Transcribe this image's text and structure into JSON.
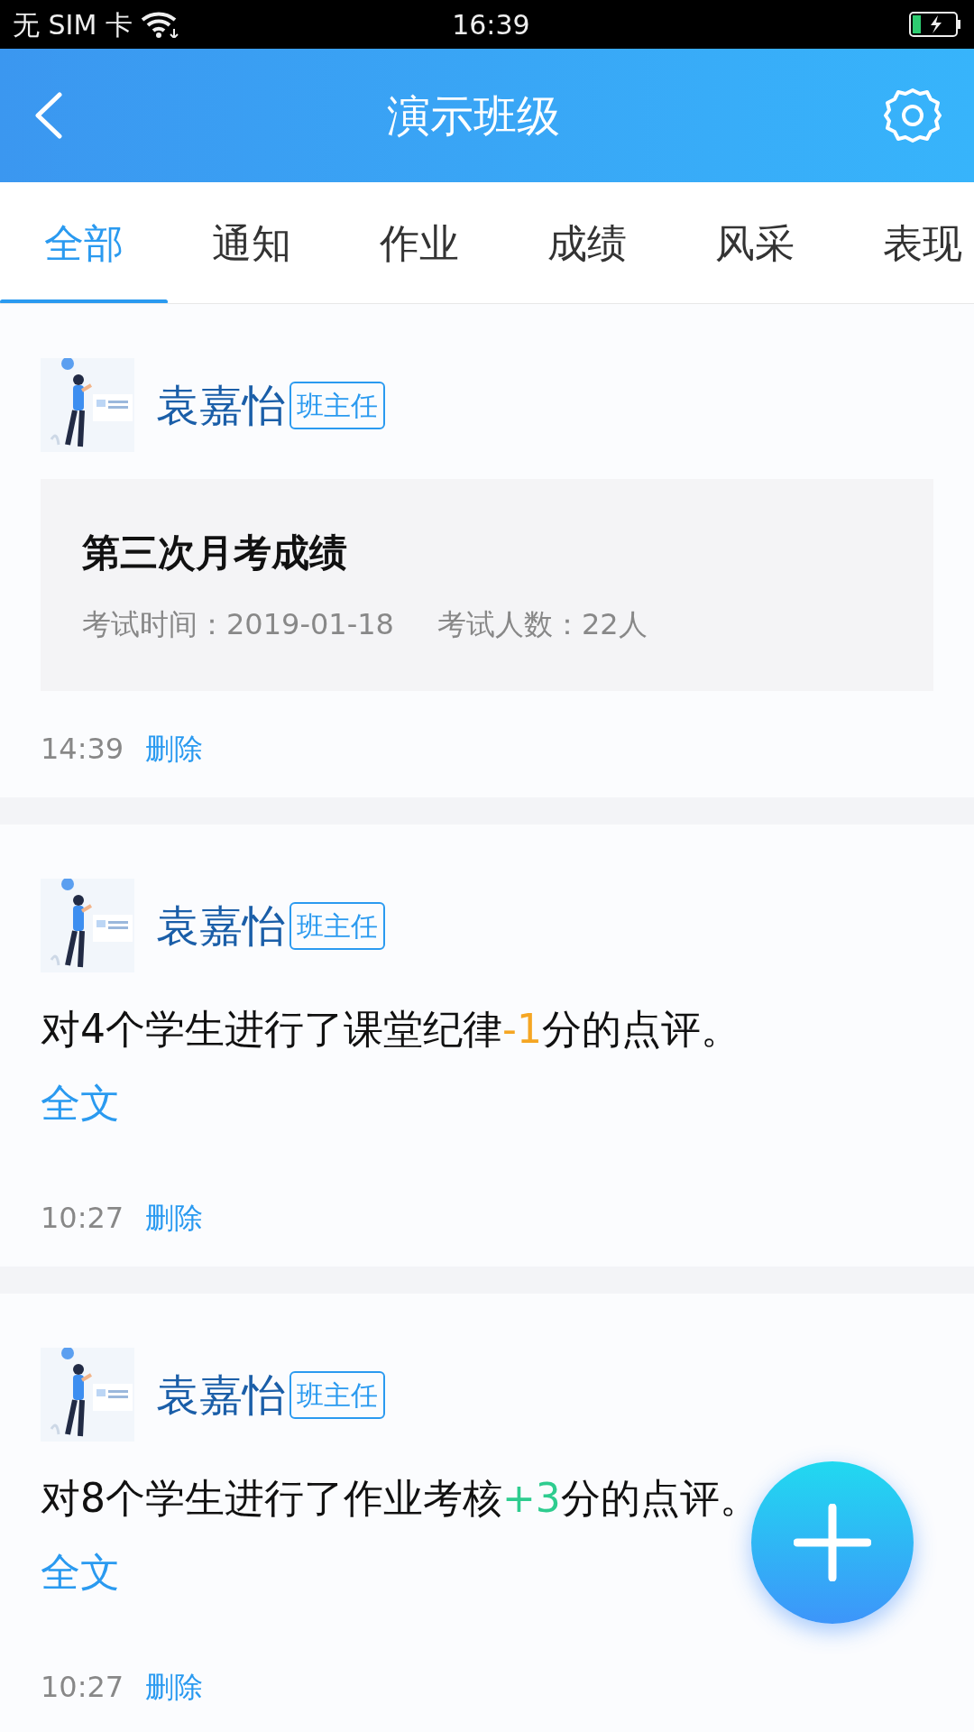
{
  "status_bar": {
    "carrier": "无 SIM 卡",
    "time": "16:39"
  },
  "header": {
    "title": "演示班级"
  },
  "tabs": [
    {
      "label": "全部",
      "selected": true
    },
    {
      "label": "通知",
      "selected": false
    },
    {
      "label": "作业",
      "selected": false
    },
    {
      "label": "成绩",
      "selected": false
    },
    {
      "label": "风采",
      "selected": false
    },
    {
      "label": "表现",
      "selected": false
    }
  ],
  "posts": [
    {
      "kind": "exam",
      "author": "袁嘉怡",
      "role": "班主任",
      "title": "第三次月考成绩",
      "exam_date": "考试时间：2019-01-18",
      "exam_count": "考试人数：22人",
      "time": "14:39",
      "delete": "删除"
    },
    {
      "kind": "comment",
      "author": "袁嘉怡",
      "role": "班主任",
      "text_before": "对4个学生进行了课堂纪律",
      "score": "-1",
      "color": "#f5a623",
      "text_after": "分的点评。",
      "more": "全文",
      "time": "10:27",
      "delete": "删除"
    },
    {
      "kind": "comment",
      "author": "袁嘉怡",
      "role": "班主任",
      "text_before": "对8个学生进行了作业考核",
      "score": "+3",
      "color": "#2ecc8f",
      "text_after": "分的点评。",
      "more": "全文",
      "time": "10:27",
      "delete": "删除"
    }
  ]
}
